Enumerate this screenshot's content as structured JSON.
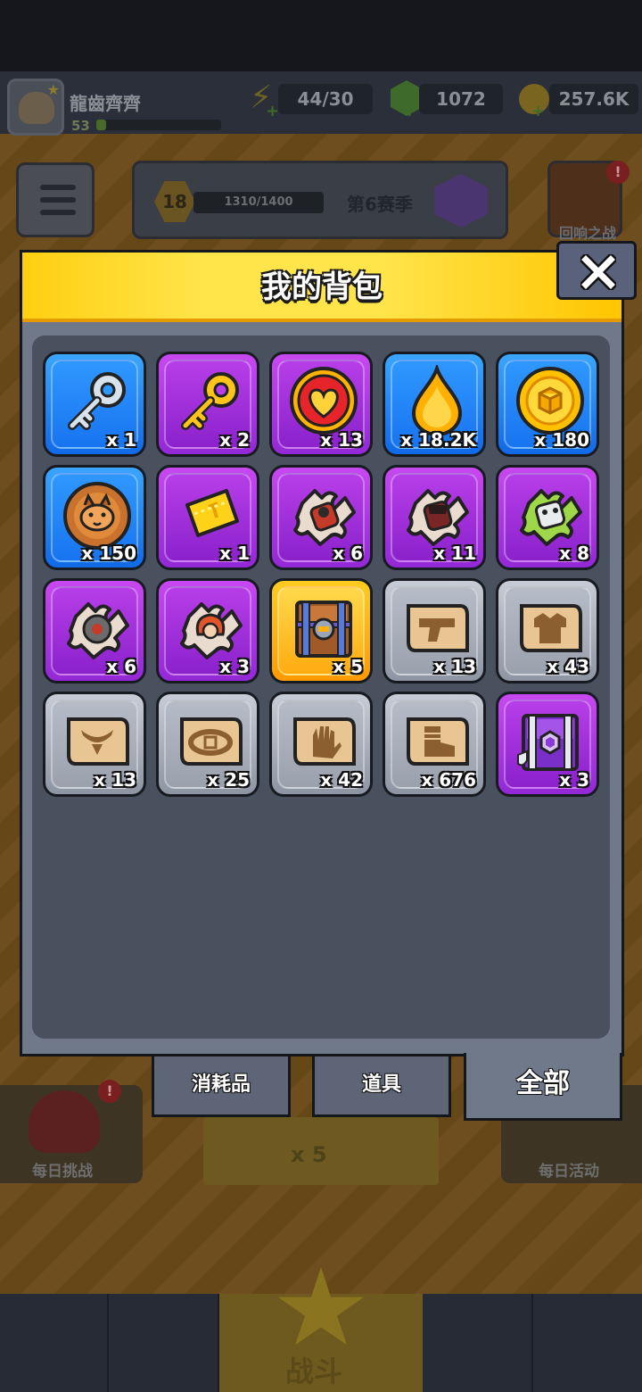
{
  "player": {
    "name": "龍齒齊齊",
    "level": "53",
    "xp_fraction": 0.08
  },
  "resources": {
    "energy": "44/30",
    "gems": "1072",
    "coins": "257.6K"
  },
  "season": {
    "level": "18",
    "progress": "1310/1400",
    "progress_fraction": 0.05,
    "label": "第6赛季"
  },
  "event": {
    "echo_label": "回响之战",
    "badge": "!"
  },
  "sides": {
    "daily_challenge": "每日挑战",
    "daily_events": "每日活动"
  },
  "start": {
    "cost": "x 5"
  },
  "nav": {
    "battle": "战斗"
  },
  "backpack": {
    "title": "我的背包",
    "close_icon": "close-icon",
    "items": [
      {
        "icon": "silver-key-icon",
        "rarity": "blue",
        "qty": "x 1"
      },
      {
        "icon": "gold-key-icon",
        "rarity": "purple",
        "qty": "x 2"
      },
      {
        "icon": "heart-icon",
        "rarity": "purple",
        "qty": "x 13"
      },
      {
        "icon": "flame-drop-icon",
        "rarity": "blue",
        "qty": "x 18.2K"
      },
      {
        "icon": "gold-coin-icon",
        "rarity": "blue",
        "qty": "x 180"
      },
      {
        "icon": "dog-cookie-icon",
        "rarity": "blue",
        "qty": "x 150"
      },
      {
        "icon": "gold-ticket-icon",
        "rarity": "purple",
        "qty": "x 1"
      },
      {
        "icon": "puzzle-piece-icon",
        "rarity": "purple",
        "qty": "x 6"
      },
      {
        "icon": "puzzle-piece-icon",
        "rarity": "purple",
        "qty": "x 11"
      },
      {
        "icon": "puzzle-piece-icon",
        "rarity": "purple",
        "qty": "x 8"
      },
      {
        "icon": "puzzle-piece-icon",
        "rarity": "purple",
        "qty": "x 6"
      },
      {
        "icon": "puzzle-piece-icon",
        "rarity": "purple",
        "qty": "x 3"
      },
      {
        "icon": "treasure-chest-icon",
        "rarity": "gold",
        "qty": "x 5"
      },
      {
        "icon": "gun-scroll-icon",
        "rarity": "gray",
        "qty": "x 13"
      },
      {
        "icon": "armor-scroll-icon",
        "rarity": "gray",
        "qty": "x 43"
      },
      {
        "icon": "necklace-scroll-icon",
        "rarity": "gray",
        "qty": "x 13"
      },
      {
        "icon": "belt-scroll-icon",
        "rarity": "gray",
        "qty": "x 25"
      },
      {
        "icon": "glove-scroll-icon",
        "rarity": "gray",
        "qty": "x 42"
      },
      {
        "icon": "boot-scroll-icon",
        "rarity": "gray",
        "qty": "x 676"
      },
      {
        "icon": "purple-chest-icon",
        "rarity": "purple",
        "qty": "x 3"
      }
    ],
    "tabs": {
      "consumables": "消耗品",
      "items": "道具",
      "all": "全部"
    }
  },
  "colors": {
    "header_yellow": "#ffd52a",
    "rarity_blue": "#1f7df0",
    "rarity_purple": "#a032de",
    "rarity_gold": "#ffb000",
    "rarity_gray": "#a7adb8"
  }
}
